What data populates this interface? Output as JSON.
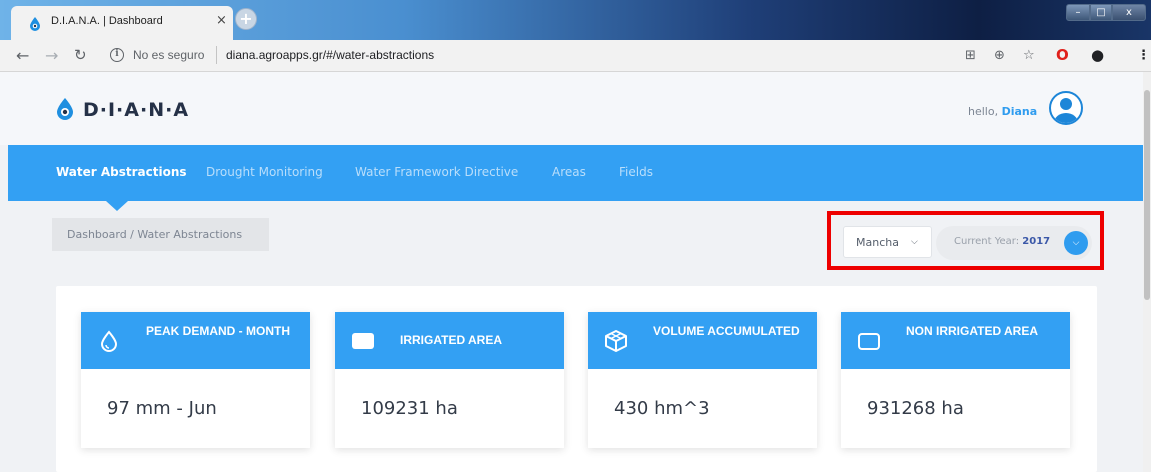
{
  "browser": {
    "tab_title": "D.I.A.N.A. | Dashboard",
    "tab_close": "×",
    "new_tab": "+",
    "insecure_label": "No es seguro",
    "url": "diana.agroapps.gr/#/water-abstractions"
  },
  "header": {
    "logo": "D·I·A·N·A",
    "greeting": "hello, ",
    "user_name": "Diana"
  },
  "nav": {
    "items": [
      {
        "label": "Water Abstractions",
        "active": true
      },
      {
        "label": "Drought Monitoring",
        "active": false
      },
      {
        "label": "Water Framework Directive",
        "active": false
      },
      {
        "label": "Areas",
        "active": false
      },
      {
        "label": "Fields",
        "active": false
      }
    ]
  },
  "breadcrumb": {
    "text": "Dashboard  / Water Abstractions"
  },
  "filters": {
    "region": "Mancha",
    "year_label": "Current Year: ",
    "year_value": "2017"
  },
  "cards": [
    {
      "title": "PEAK DEMAND - MONTH",
      "value": "97 mm - Jun",
      "icon": "water-drop-icon"
    },
    {
      "title": "IRRIGATED AREA",
      "value": "109231 ha",
      "icon": "filled-rectangle-icon"
    },
    {
      "title": "VOLUME ACCUMULATED",
      "value": "430 hm^3",
      "icon": "cube-icon"
    },
    {
      "title": "NON IRRIGATED AREA",
      "value": "931268 ha",
      "icon": "outline-rectangle-icon"
    }
  ],
  "colors": {
    "brand_blue": "#33a0f3",
    "highlight": "#ee0000",
    "logo_dark": "#253147"
  }
}
